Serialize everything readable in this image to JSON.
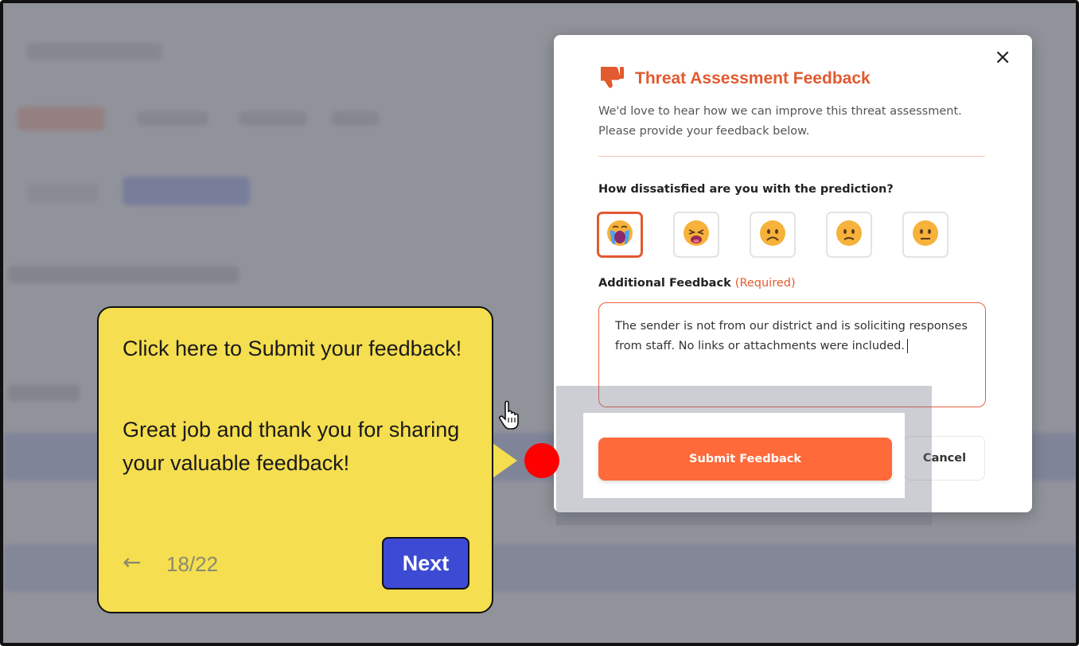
{
  "modal": {
    "title": "Threat Assessment Feedback",
    "description": "We'd love to hear how we can improve this threat assessment. Please provide your feedback below.",
    "question": "How dissatisfied are you with the prediction?",
    "feedback_label": "Additional Feedback",
    "feedback_required": "(Required)",
    "feedback_text": "The sender is not from our district and is soliciting responses from staff. No links or attachments were included.",
    "submit_label": "Submit Feedback",
    "cancel_label": "Cancel",
    "close_glyph": "×",
    "ratings": [
      "crying-face",
      "weary-face",
      "frowning-face",
      "slightly-frowning-face",
      "neutral-face"
    ],
    "selected_rating": "crying-face"
  },
  "tooltip": {
    "line1": "Click here to Submit your feedback!",
    "line2": "Great job and thank you for sharing your valuable feedback!",
    "back_glyph": "←",
    "counter": "18/22",
    "next_label": "Next"
  },
  "colors": {
    "accent": "#e25a2f",
    "submit": "#fe6a3a",
    "tooltip_bg": "#f5de50",
    "next_bg": "#3d4bd4",
    "marker": "#ff0000"
  }
}
